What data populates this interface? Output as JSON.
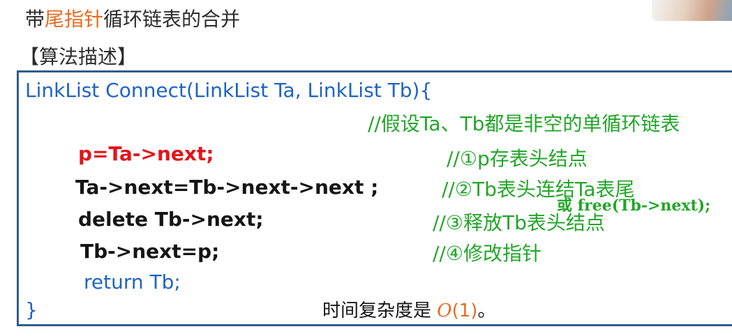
{
  "title": {
    "pre": "带",
    "highlight": "尾指针",
    "post": "循环链表的合并"
  },
  "subtitle": "【算法描述】",
  "code": {
    "header": "LinkList  Connect(LinkList  Ta, LinkList  Tb){",
    "assume_comment": "//假设Ta、Tb都是非空的单循环链表",
    "line1": "p=Ta->next;",
    "comment1": "//①p存表头结点",
    "line2": "Ta->next=Tb->next->next ;",
    "comment2": "//②Tb表头连结Ta表尾",
    "free_note": "或 free(Tb->next);",
    "line3": "delete Tb->next;",
    "comment3": "//③释放Tb表头结点",
    "line4": "Tb->next=p;",
    "comment4": "//④修改指针",
    "line5": "return  Tb;",
    "close": "}"
  },
  "complexity": {
    "pre": "时间复杂度是 ",
    "o": "O",
    "arg": "(1)",
    "post": "。"
  },
  "colors": {
    "title_highlight": "#e66b1e",
    "code_blue": "#1f63c4",
    "comment_green": "#22a628",
    "code_red": "#e4141b",
    "border": "#2f5d8a"
  }
}
